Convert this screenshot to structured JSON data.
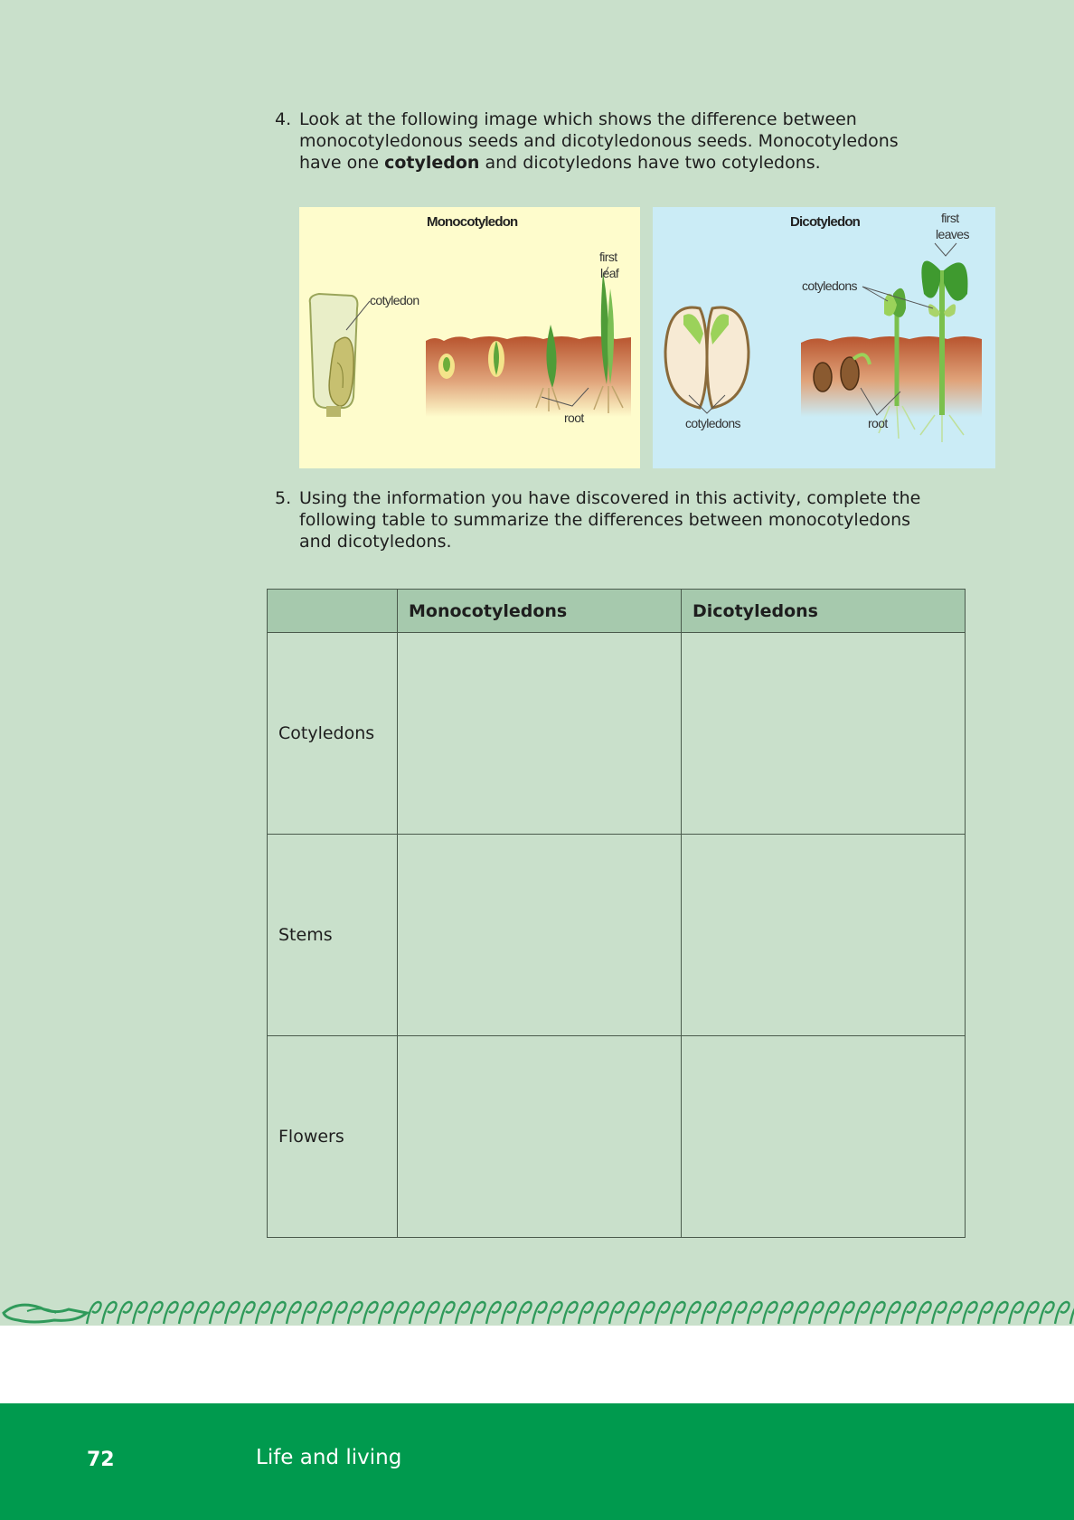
{
  "question4": {
    "number": "4.",
    "line1": "Look at the following image which shows the difference between",
    "line2": "monocotyledonous seeds and dicotyledonous seeds. Monocotyledons",
    "line3_pre": "have one ",
    "line3_bold": "cotyledon",
    "line3_post": " and dicotyledons have two cotyledons."
  },
  "figure": {
    "mono": {
      "title": "Monocotyledon",
      "cotyledon_label": "cotyledon",
      "first_leaf_1": "first",
      "first_leaf_2": "leaf",
      "root_label": "root"
    },
    "dico": {
      "title": "Dicotyledon",
      "first_leaves_1": "first",
      "first_leaves_2": "leaves",
      "cotyledons_label": "cotyledons",
      "seed_cotyledons_label": "cotyledons",
      "root_label": "root"
    }
  },
  "question5": {
    "number": "5.",
    "line1": "Using the information you have discovered in this activity, complete the",
    "line2": "following table to summarize the differences between monocotyledons",
    "line3": "and dicotyledons."
  },
  "table": {
    "headers": [
      "",
      "Monocotyledons",
      "Dicotyledons"
    ],
    "rows": [
      {
        "label": "Cotyledons",
        "mono": "",
        "dico": ""
      },
      {
        "label": "Stems",
        "mono": "",
        "dico": ""
      },
      {
        "label": "Flowers",
        "mono": "",
        "dico": ""
      }
    ]
  },
  "footer": {
    "page_number": "72",
    "section_title": "Life and living"
  },
  "colors": {
    "page_background": "#c9e0cb",
    "table_header": "#a6c9ad",
    "footer_green": "#009a4e",
    "wave_green": "#2f9a5a"
  }
}
